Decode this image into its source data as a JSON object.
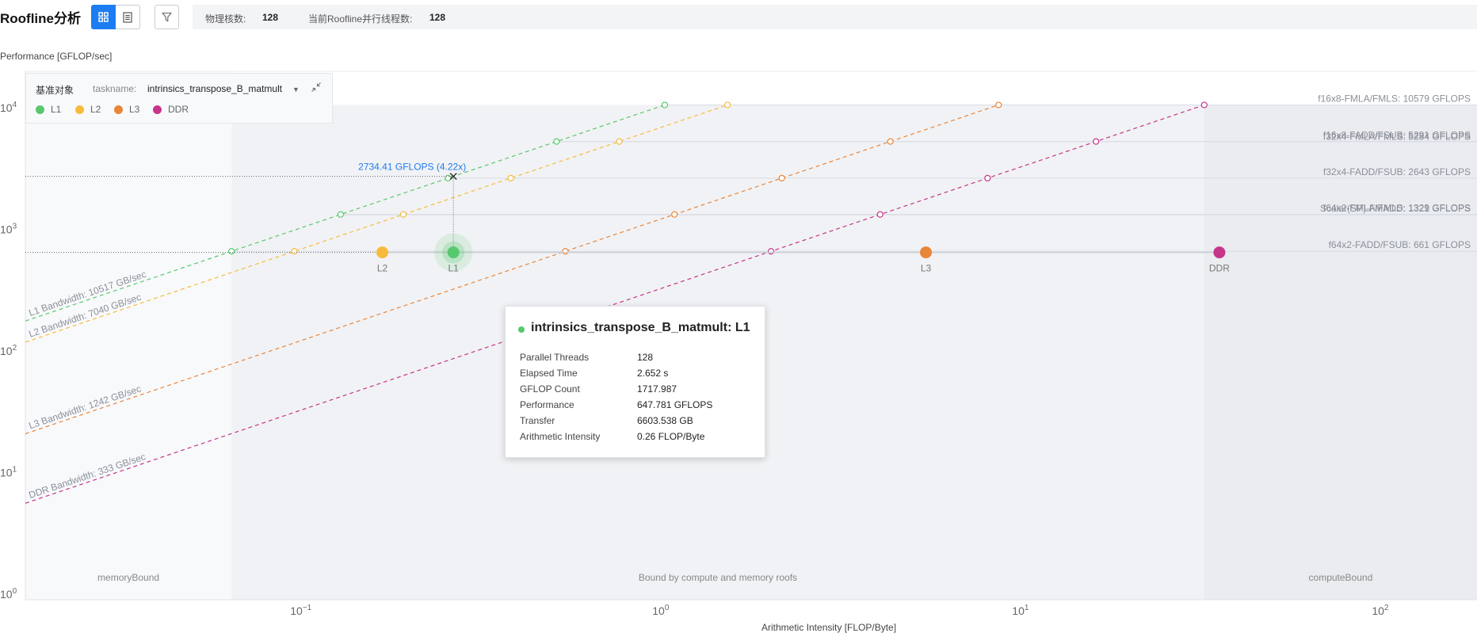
{
  "header": {
    "title": "Roofline分析",
    "physical_cores_label": "物理核数:",
    "physical_cores_value": "128",
    "roofline_threads_label": "当前Roofline并行线程数:",
    "roofline_threads_value": "128",
    "grid_icon": "grid-view-icon",
    "list_icon": "list-view-icon",
    "filter_icon": "filter-icon"
  },
  "legend": {
    "baseline_label": "基准对象",
    "taskname_key": "taskname:",
    "taskname_value": "intrinsics_transpose_B_matmult",
    "items": [
      {
        "label": "L1",
        "color": "#58c86e"
      },
      {
        "label": "L2",
        "color": "#f7bb3c"
      },
      {
        "label": "L3",
        "color": "#e8863a"
      },
      {
        "label": "DDR",
        "color": "#c5368a"
      }
    ]
  },
  "tooltip": {
    "title": "intrinsics_transpose_B_matmult: L1",
    "rows": [
      {
        "k": "Parallel Threads",
        "v": "128"
      },
      {
        "k": "Elapsed Time",
        "v": "2.652 s"
      },
      {
        "k": "GFLOP Count",
        "v": "1717.987"
      },
      {
        "k": "Performance",
        "v": "647.781 GFLOPS"
      },
      {
        "k": "Transfer",
        "v": "6603.538 GB"
      },
      {
        "k": "Arithmetic Intensity",
        "v": "0.26 FLOP/Byte"
      }
    ]
  },
  "chart_data": {
    "type": "scatter",
    "xscale": "log",
    "yscale": "log",
    "xlabel": "Arithmetic Intensity [FLOP/Byte]",
    "ylabel": "Performance [GFLOP/sec]",
    "xlim": [
      0.0168,
      182
    ],
    "ylim": [
      0.9,
      20000
    ],
    "x_ticks": [
      {
        "value": 0.1,
        "base": "10",
        "exp": "−1"
      },
      {
        "value": 1,
        "base": "10",
        "exp": "0"
      },
      {
        "value": 10,
        "base": "10",
        "exp": "1"
      },
      {
        "value": 100,
        "base": "10",
        "exp": "2"
      }
    ],
    "y_ticks": [
      {
        "value": 1,
        "base": "10",
        "exp": "0"
      },
      {
        "value": 10,
        "base": "10",
        "exp": "1"
      },
      {
        "value": 100,
        "base": "10",
        "exp": "2"
      },
      {
        "value": 1000,
        "base": "10",
        "exp": "3"
      },
      {
        "value": 10000,
        "base": "10",
        "exp": "4"
      }
    ],
    "bandwidths": [
      {
        "name": "L1",
        "label": "L1 Bandwidth: 10517 GB/sec",
        "bw": 10517,
        "color": "#58c86e"
      },
      {
        "name": "L2",
        "label": "L2 Bandwidth: 7040 GB/sec",
        "bw": 7040,
        "color": "#f7bb3c"
      },
      {
        "name": "L3",
        "label": "L3 Bandwidth: 1242 GB/sec",
        "bw": 1242,
        "color": "#e8863a"
      },
      {
        "name": "DDR",
        "label": "DDR Bandwidth: 333 GB/sec",
        "bw": 333,
        "color": "#c5368a"
      }
    ],
    "compute_roofs": [
      {
        "label": "f16x8-FMLA/FMLS: 10579 GFLOPS",
        "value": 10579
      },
      {
        "label": "f16x8-FADD/FSUB: 5291 GFLOPS",
        "value": 5291
      },
      {
        "label": "f32x4-FMLA/FMLS: 5284 GFLOPS",
        "value": 5284
      },
      {
        "label": "f32x4-FADD/FSUB: 2643 GFLOPS",
        "value": 2643
      },
      {
        "label": "f64x2-FMLA/FMLS: 1329 GFLOPS",
        "value": 1329
      },
      {
        "label": "Scalar(SP)-FMADD: 1321 GFLOPS",
        "value": 1321
      },
      {
        "label": "f64x2-FADD/FSUB: 661 GFLOPS",
        "value": 661
      }
    ],
    "points": [
      {
        "name": "L2",
        "x": 0.165,
        "y": 647.781,
        "color": "#f7bb3c"
      },
      {
        "name": "L1",
        "x": 0.26,
        "y": 647.781,
        "color": "#58c86e"
      },
      {
        "name": "L3",
        "x": 5.35,
        "y": 647.781,
        "color": "#e8863a"
      },
      {
        "name": "DDR",
        "x": 35.0,
        "y": 647.781,
        "color": "#c5368a"
      }
    ],
    "projection": {
      "x": 0.26,
      "y": 2734.41,
      "label": "2734.41 GFLOPS (4.22x)"
    },
    "regions": [
      {
        "label": "memoryBound",
        "x0": 0.0168,
        "x1": 0.06285
      },
      {
        "label": "Bound by compute and memory roofs",
        "x0": 0.06285,
        "x1": 31.77
      },
      {
        "label": "computeBound",
        "x0": 31.77,
        "x1": 182
      }
    ]
  }
}
